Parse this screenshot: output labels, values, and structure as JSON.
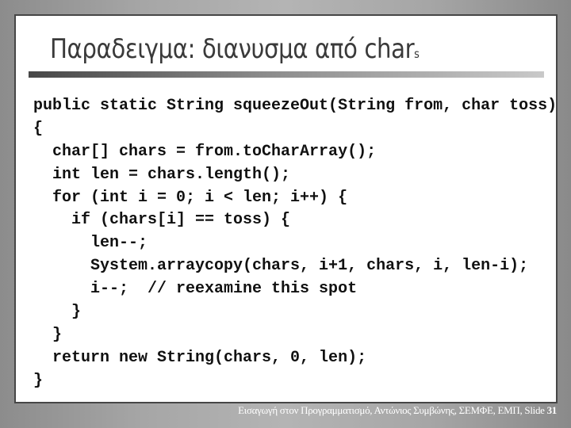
{
  "slide": {
    "title": "Παραδειγμα: διανυσμα από char",
    "title_suffix": "s",
    "code_lines": [
      "public static String squeezeOut(String from, char toss)",
      "{",
      "  char[] chars = from.toCharArray();",
      "  int len = chars.length();",
      "  for (int i = 0; i < len; i++) {",
      "    if (chars[i] == toss) {",
      "      len--;",
      "      System.arraycopy(chars, i+1, chars, i, len-i);",
      "      i--;  // reexamine this spot",
      "    }",
      "  }",
      "  return new String(chars, 0, len);",
      "}"
    ]
  },
  "footer": {
    "text": "Εισαγωγή στον Προγραμματισμό, Αντώνιος Συμβώνης, ΣΕΜΦΕ, ΕΜΠ, Slide ",
    "slide_number": "31"
  }
}
